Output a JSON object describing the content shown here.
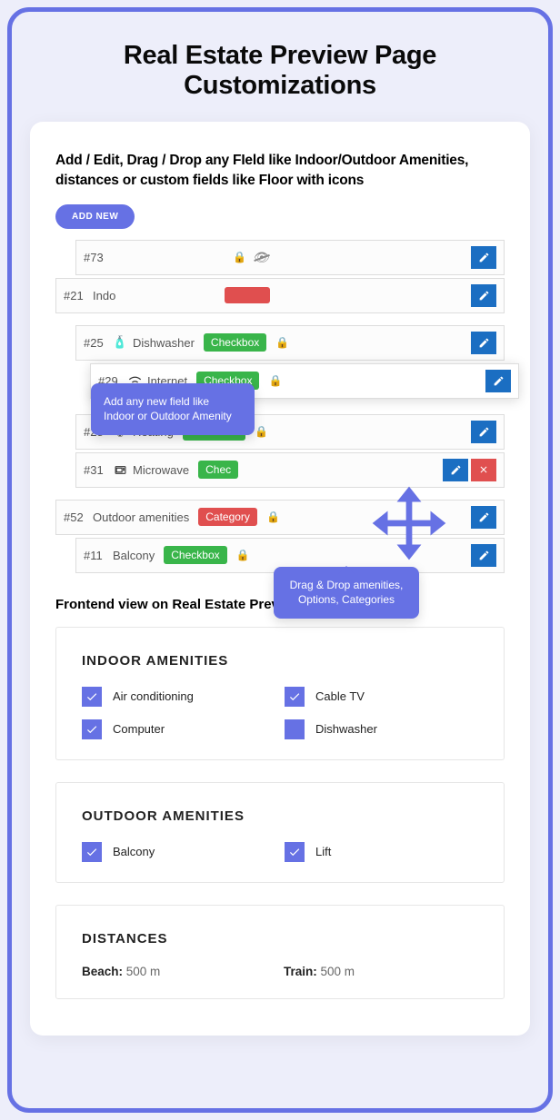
{
  "page_title": "Real Estate Preview Page Customizations",
  "section_heading": "Add / Edit, Drag / Drop any FIeld like Indoor/Outdoor Amenities, distances or custom fields like Floor with icons",
  "add_new_label": "ADD NEW",
  "tooltips": {
    "add_new": "Add any new field like Indoor or Outdoor Amenity",
    "drag": "Drag & Drop amenities, Options, Categories"
  },
  "rows": [
    {
      "id": "#73",
      "label": "",
      "badge": "",
      "badge_color": "",
      "lock": true,
      "hidden_eye": true,
      "icon": "",
      "indent": 1,
      "actions": [
        "edit"
      ]
    },
    {
      "id": "#21",
      "label": "Indo",
      "badge": "",
      "badge_color": "red",
      "lock": false,
      "icon": "",
      "indent": 0,
      "actions": [
        "edit"
      ]
    },
    {
      "id": "#25",
      "label": "Dishwasher",
      "badge": "Checkbox",
      "badge_color": "green",
      "lock": true,
      "icon": "dishwasher",
      "indent": 1,
      "actions": [
        "edit"
      ]
    },
    {
      "id": "#29",
      "label": "Internet",
      "badge": "Checkbox",
      "badge_color": "green",
      "lock": true,
      "icon": "wifi",
      "indent": 2,
      "dragging": true,
      "actions": [
        "edit"
      ]
    },
    {
      "id": "#28",
      "label": "Heating",
      "badge": "Checkbox",
      "badge_color": "green",
      "lock": true,
      "icon": "thermometer",
      "indent": 1,
      "actions": [
        "edit"
      ]
    },
    {
      "id": "#31",
      "label": "Microwave",
      "badge": "Chec",
      "badge_color": "green",
      "lock": false,
      "icon": "microwave",
      "indent": 1,
      "actions": [
        "edit",
        "delete"
      ]
    },
    {
      "id": "#52",
      "label": "Outdoor amenities",
      "badge": "Category",
      "badge_color": "red",
      "lock": true,
      "lock_red": true,
      "icon": "",
      "indent": 0,
      "actions": [
        "edit"
      ]
    },
    {
      "id": "#11",
      "label": "Balcony",
      "badge": "Checkbox",
      "badge_color": "green",
      "lock": true,
      "icon": "",
      "indent": 1,
      "actions": [
        "edit"
      ]
    }
  ],
  "frontend_title": "Frontend view on Real Estate Preview",
  "panels": {
    "indoor": {
      "title": "INDOOR AMENITIES",
      "items": [
        {
          "label": "Air conditioning",
          "checked": true
        },
        {
          "label": "Cable TV",
          "checked": true
        },
        {
          "label": "Computer",
          "checked": true
        },
        {
          "label": "Dishwasher",
          "checked": false
        }
      ]
    },
    "outdoor": {
      "title": "OUTDOOR AMENITIES",
      "items": [
        {
          "label": "Balcony",
          "checked": true
        },
        {
          "label": "Lift",
          "checked": true
        }
      ]
    },
    "distances": {
      "title": "DISTANCES",
      "items": [
        {
          "label": "Beach:",
          "value": "500 m"
        },
        {
          "label": "Train:",
          "value": "500 m"
        }
      ]
    }
  }
}
